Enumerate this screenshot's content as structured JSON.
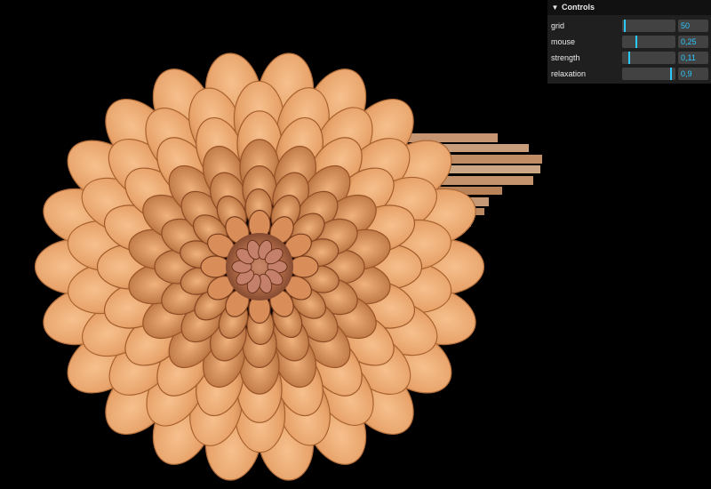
{
  "stage": {
    "background": "#000000",
    "image": "orange dahlia flower with grid displacement distortion"
  },
  "controls": {
    "title": "Controls",
    "toggle_icon": "chevron-down-icon",
    "accent_color": "#2cc9ff",
    "items": [
      {
        "key": "grid",
        "label": "grid",
        "value": "50",
        "fraction": 0.03
      },
      {
        "key": "mouse",
        "label": "mouse",
        "value": "0,25",
        "fraction": 0.25
      },
      {
        "key": "strength",
        "label": "strength",
        "value": "0,11",
        "fraction": 0.11
      },
      {
        "key": "relaxation",
        "label": "relaxation",
        "value": "0,9",
        "fraction": 0.9
      }
    ]
  }
}
